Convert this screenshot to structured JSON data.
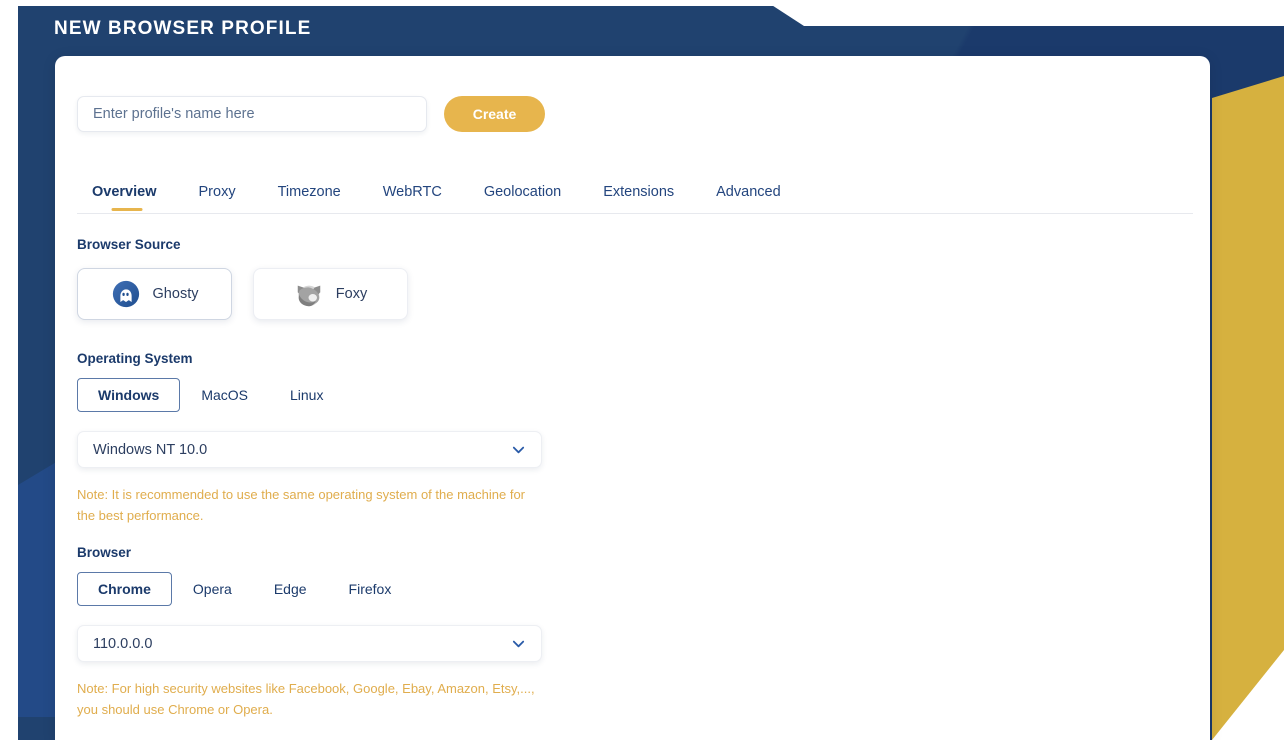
{
  "header": {
    "title": "NEW BROWSER PROFILE"
  },
  "profile_form": {
    "name_value": "",
    "name_placeholder": "Enter profile's name here",
    "create_label": "Create"
  },
  "tabs": [
    {
      "label": "Overview",
      "active": true
    },
    {
      "label": "Proxy",
      "active": false
    },
    {
      "label": "Timezone",
      "active": false
    },
    {
      "label": "WebRTC",
      "active": false
    },
    {
      "label": "Geolocation",
      "active": false
    },
    {
      "label": "Extensions",
      "active": false
    },
    {
      "label": "Advanced",
      "active": false
    }
  ],
  "browser_source": {
    "label": "Browser Source",
    "options": [
      {
        "label": "Ghosty",
        "icon": "ghost-icon",
        "selected": true
      },
      {
        "label": "Foxy",
        "icon": "fox-icon",
        "selected": false
      }
    ]
  },
  "operating_system": {
    "label": "Operating System",
    "options": [
      {
        "label": "Windows",
        "selected": true
      },
      {
        "label": "MacOS",
        "selected": false
      },
      {
        "label": "Linux",
        "selected": false
      }
    ],
    "version_selected": "Windows NT 10.0",
    "note": "Note: It is recommended to use the same operating system of the machine for the best performance."
  },
  "browser": {
    "label": "Browser",
    "options": [
      {
        "label": "Chrome",
        "selected": true
      },
      {
        "label": "Opera",
        "selected": false
      },
      {
        "label": "Edge",
        "selected": false
      },
      {
        "label": "Firefox",
        "selected": false
      }
    ],
    "version_selected": "110.0.0.0",
    "note": "Note: For high security websites like Facebook, Google, Ebay, Amazon, Etsy,..., you should use Chrome or Opera."
  },
  "colors": {
    "navy": "#1b3a6b",
    "blue_band": "#234a87",
    "gold": "#d6b13f",
    "accent_button": "#e7b54d",
    "note_text": "#e0ad4d",
    "text_primary": "#2c3e60"
  }
}
